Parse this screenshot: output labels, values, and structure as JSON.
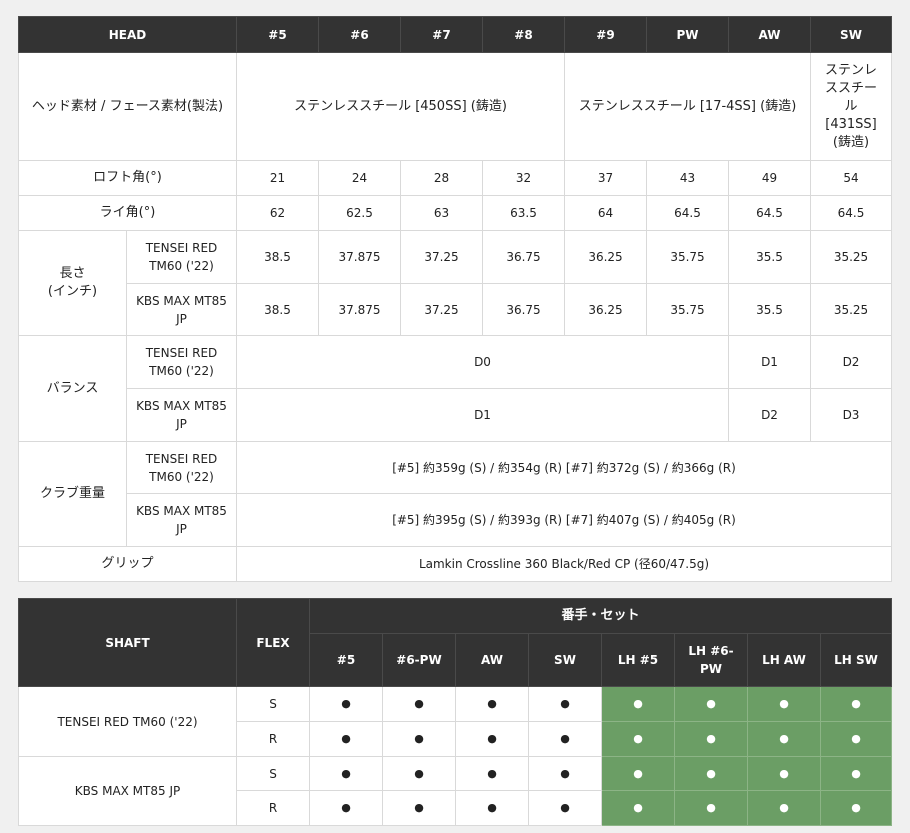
{
  "spec": {
    "header": [
      "HEAD",
      "#5",
      "#6",
      "#7",
      "#8",
      "#9",
      "PW",
      "AW",
      "SW"
    ],
    "material": {
      "label": "ヘッド素材 / フェース素材(製法)",
      "group1": "ステンレススチール [450SS] (鋳造)",
      "group2": "ステンレススチール [17-4SS] (鋳造)",
      "sw_l1": "ステンレ",
      "sw_l2": "ススチー",
      "sw_l3": "ル",
      "sw_l4": "[431SS]",
      "sw_l5": "(鋳造)"
    },
    "loft": {
      "label": "ロフト角(°)",
      "values": [
        "21",
        "24",
        "28",
        "32",
        "37",
        "43",
        "49",
        "54"
      ]
    },
    "lie": {
      "label": "ライ角(°)",
      "values": [
        "62",
        "62.5",
        "63",
        "63.5",
        "64",
        "64.5",
        "64.5",
        "64.5"
      ]
    },
    "length": {
      "label_l1": "長さ",
      "label_l2": "(インチ)",
      "tensei_l1": "TENSEI RED",
      "tensei_l2": "TM60 ('22)",
      "tensei_values": [
        "38.5",
        "37.875",
        "37.25",
        "36.75",
        "36.25",
        "35.75",
        "35.5",
        "35.25"
      ],
      "kbs_l1": "KBS MAX MT85",
      "kbs_l2": "JP",
      "kbs_values": [
        "38.5",
        "37.875",
        "37.25",
        "36.75",
        "36.25",
        "35.75",
        "35.5",
        "35.25"
      ]
    },
    "balance": {
      "label": "バランス",
      "tensei_l1": "TENSEI RED",
      "tensei_l2": "TM60 ('22)",
      "tensei_main": "D0",
      "tensei_aw": "D1",
      "tensei_sw": "D2",
      "kbs_l1": "KBS MAX MT85",
      "kbs_l2": "JP",
      "kbs_main": "D1",
      "kbs_aw": "D2",
      "kbs_sw": "D3"
    },
    "weight": {
      "label": "クラブ重量",
      "tensei_l1": "TENSEI RED",
      "tensei_l2": "TM60 ('22)",
      "tensei_value": "[#5] 約359g (S) / 約354g (R)  [#7] 約372g (S) / 約366g (R)",
      "kbs_l1": "KBS MAX MT85",
      "kbs_l2": "JP",
      "kbs_value": "[#5] 約395g (S) / 約393g (R)  [#7] 約407g (S) / 約405g (R)"
    },
    "grip": {
      "label": "グリップ",
      "value": "Lamkin Crossline 360 Black/Red CP (径60/47.5g)"
    }
  },
  "shaft_table": {
    "shaft_header": "SHAFT",
    "flex_header": "FLEX",
    "set_header": "番手・セット",
    "columns_l1": [
      "#5",
      "#6-PW",
      "AW",
      "SW",
      "LH #5",
      "LH #6-",
      "LH AW",
      "LH SW"
    ],
    "col6_l2": "PW",
    "dot": "●",
    "rows": [
      {
        "shaft": "TENSEI RED TM60 ('22)",
        "flex": [
          "S",
          "R"
        ]
      },
      {
        "shaft": "KBS MAX MT85 JP",
        "flex": [
          "S",
          "R"
        ]
      }
    ]
  },
  "colors": {
    "header_bg": "#333333",
    "lh_green": "#6b9e65"
  }
}
